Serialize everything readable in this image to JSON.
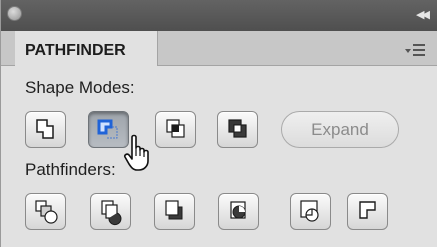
{
  "panel": {
    "tab_label": "PATHFINDER",
    "shape_modes_label": "Shape Modes:",
    "pathfinders_label": "Pathfinders:",
    "expand_label": "Expand",
    "shape_mode_buttons": [
      {
        "icon": "unite-icon",
        "state": "normal"
      },
      {
        "icon": "minus-front-icon",
        "state": "pressed"
      },
      {
        "icon": "intersect-icon",
        "state": "normal"
      },
      {
        "icon": "exclude-icon",
        "state": "normal"
      }
    ],
    "pathfinder_buttons": [
      {
        "icon": "divide-icon"
      },
      {
        "icon": "trim-icon"
      },
      {
        "icon": "merge-icon"
      },
      {
        "icon": "crop-icon"
      },
      {
        "icon": "outline-icon"
      },
      {
        "icon": "minus-back-icon"
      }
    ],
    "cursor": "hand-pointer-icon",
    "colors": {
      "panel_bg": "#e1e1e1",
      "title_bar": "#575757",
      "selected_accent": "#2a6fe0",
      "disabled_text": "#8b8b8b"
    }
  }
}
